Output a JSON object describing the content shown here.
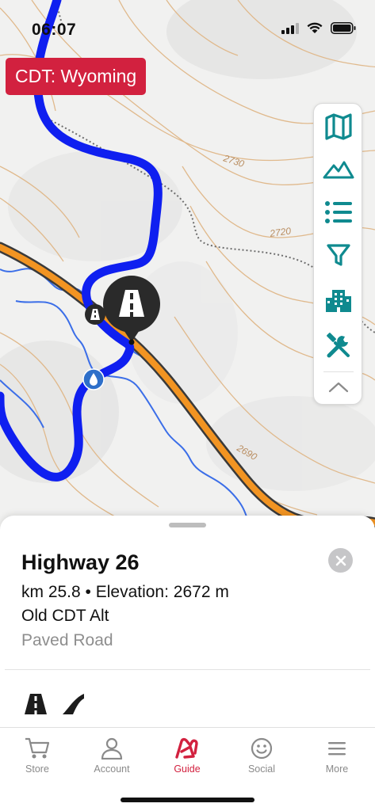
{
  "status_bar": {
    "time": "06:07"
  },
  "map": {
    "region": "CDT: Wyoming",
    "contour_labels": [
      "2730",
      "2720",
      "2690"
    ],
    "colors": {
      "trail": "#0f1ff0",
      "water": "#3b6ee8",
      "road_fill": "#f29422",
      "road_casing": "#3a3a3a",
      "contour": "#e0b98c",
      "accent": "#d2213f",
      "toolbar_icon": "#0f8a8f"
    },
    "toolbar": [
      "map-icon",
      "terrain-icon",
      "list-icon",
      "filter-icon",
      "town-icon",
      "tools-icon",
      "collapse-icon"
    ]
  },
  "poi": {
    "title": "Highway 26",
    "details": "km 25.8 • Elevation: 2672 m",
    "route": "Old CDT Alt",
    "type": "Paved Road",
    "icons": [
      "road-icon",
      "ramp-icon"
    ]
  },
  "tabbar": {
    "active": "Guide",
    "tabs": [
      {
        "label": "Store",
        "icon": "cart-icon"
      },
      {
        "label": "Account",
        "icon": "person-icon"
      },
      {
        "label": "Guide",
        "icon": "guide-logo-icon"
      },
      {
        "label": "Social",
        "icon": "smiley-icon"
      },
      {
        "label": "More",
        "icon": "menu-icon"
      }
    ]
  }
}
